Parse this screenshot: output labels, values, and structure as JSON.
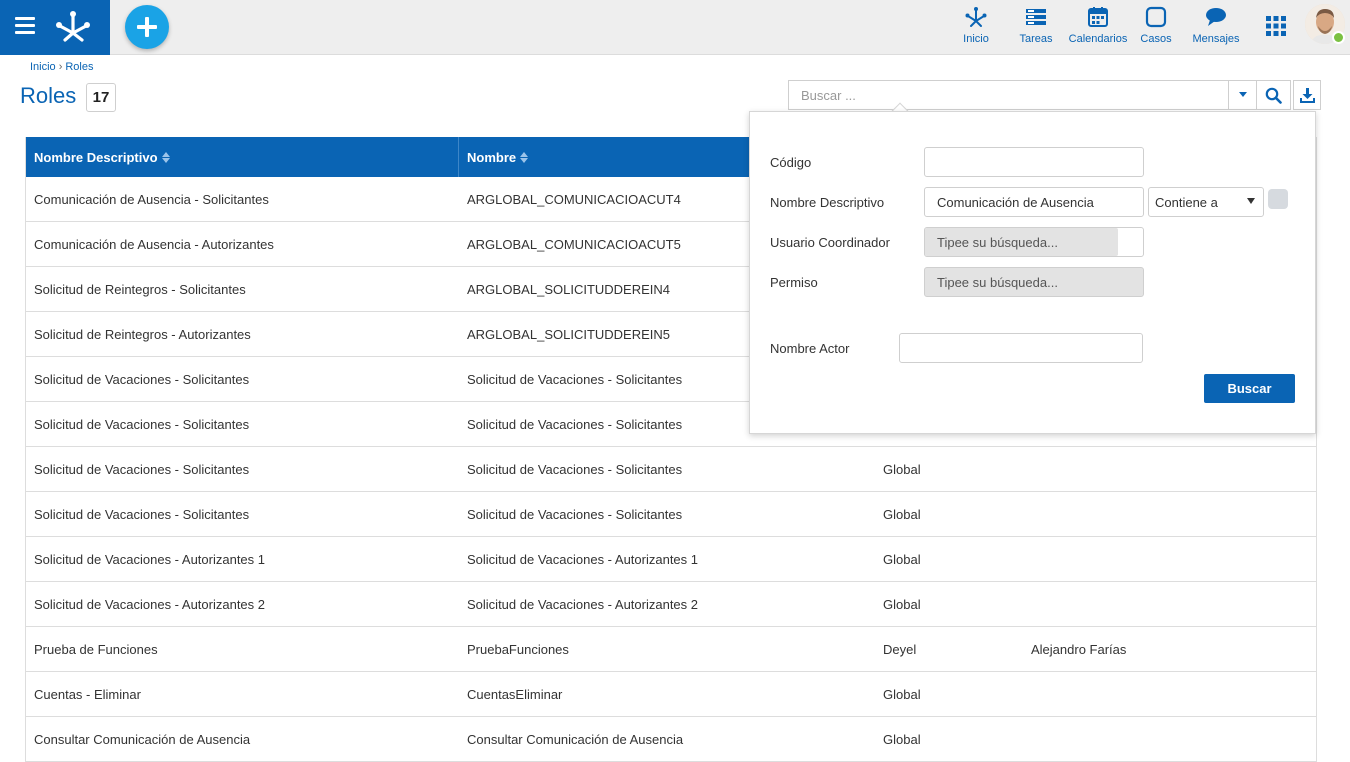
{
  "topbar": {
    "nav": [
      {
        "label": "Inicio",
        "icon": "deyel-logo-icon"
      },
      {
        "label": "Tareas",
        "icon": "tasks-icon"
      },
      {
        "label": "Calendarios",
        "icon": "calendar-icon"
      },
      {
        "label": "Casos",
        "icon": "cases-icon"
      },
      {
        "label": "Mensajes",
        "icon": "chat-bubble-icon"
      }
    ],
    "accent": "#0a64b4",
    "add_button_color": "#1aa3e6"
  },
  "breadcrumb": {
    "home": "Inicio",
    "separator": "›",
    "current": "Roles"
  },
  "page": {
    "title": "Roles",
    "count": "17"
  },
  "search": {
    "placeholder": "Buscar ..."
  },
  "table": {
    "columns": [
      "Nombre Descriptivo",
      "Nombre"
    ],
    "rows": [
      {
        "descriptive": "Comunicación de Ausencia - Solicitantes",
        "name": "ARGLOBAL_COMUNICACIOACUT4",
        "scope": "",
        "coordinator": ""
      },
      {
        "descriptive": "Comunicación de Ausencia - Autorizantes",
        "name": "ARGLOBAL_COMUNICACIOACUT5",
        "scope": "",
        "coordinator": ""
      },
      {
        "descriptive": "Solicitud de Reintegros - Solicitantes",
        "name": "ARGLOBAL_SOLICITUDDEREIN4",
        "scope": "",
        "coordinator": ""
      },
      {
        "descriptive": "Solicitud de Reintegros - Autorizantes",
        "name": "ARGLOBAL_SOLICITUDDEREIN5",
        "scope": "",
        "coordinator": ""
      },
      {
        "descriptive": "Solicitud de Vacaciones - Solicitantes",
        "name": "Solicitud de Vacaciones - Solicitantes",
        "scope": "",
        "coordinator": ""
      },
      {
        "descriptive": "Solicitud de Vacaciones - Solicitantes",
        "name": "Solicitud de Vacaciones - Solicitantes",
        "scope": "",
        "coordinator": ""
      },
      {
        "descriptive": "Solicitud de Vacaciones - Solicitantes",
        "name": "Solicitud de Vacaciones - Solicitantes",
        "scope": "Global",
        "coordinator": ""
      },
      {
        "descriptive": "Solicitud de Vacaciones - Solicitantes",
        "name": "Solicitud de Vacaciones - Solicitantes",
        "scope": "Global",
        "coordinator": ""
      },
      {
        "descriptive": "Solicitud de Vacaciones - Autorizantes 1",
        "name": "Solicitud de Vacaciones - Autorizantes 1",
        "scope": "Global",
        "coordinator": ""
      },
      {
        "descriptive": "Solicitud de Vacaciones - Autorizantes 2",
        "name": "Solicitud de Vacaciones - Autorizantes 2",
        "scope": "Global",
        "coordinator": ""
      },
      {
        "descriptive": "Prueba de Funciones",
        "name": "PruebaFunciones",
        "scope": "Deyel",
        "coordinator": "Alejandro Farías"
      },
      {
        "descriptive": "Cuentas - Eliminar",
        "name": "CuentasEliminar",
        "scope": "Global",
        "coordinator": ""
      },
      {
        "descriptive": "Consultar Comunicación de Ausencia",
        "name": "Consultar Comunicación de Ausencia",
        "scope": "Global",
        "coordinator": ""
      }
    ]
  },
  "search_panel": {
    "codigo_label": "Código",
    "codigo_value": "",
    "nombre_desc_label": "Nombre Descriptivo",
    "nombre_desc_value": "Comunicación de Ausencia",
    "operator_value": "Contiene a",
    "usuario_label": "Usuario Coordinador",
    "usuario_placeholder": "Tipee su búsqueda...",
    "permiso_label": "Permiso",
    "permiso_placeholder": "Tipee su búsqueda...",
    "actor_label": "Nombre Actor",
    "actor_value": "",
    "submit_label": "Buscar"
  }
}
